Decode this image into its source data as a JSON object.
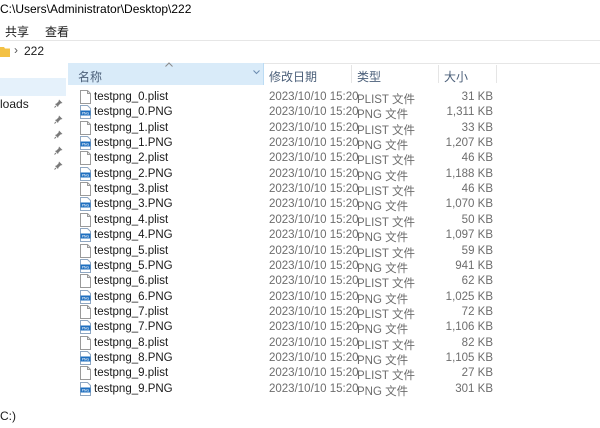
{
  "window": {
    "path": "C:\\Users\\Administrator\\Desktop\\222"
  },
  "ribbon": {
    "tabs": [
      "共享",
      "查看"
    ]
  },
  "address": {
    "crumb": "222"
  },
  "nav": {
    "items": [
      "loads",
      "C:)"
    ]
  },
  "columns": {
    "name": "名称",
    "date": "修改日期",
    "type": "类型",
    "size": "大小"
  },
  "files": [
    {
      "name": "testpng_0.plist",
      "date": "2023/10/10 15:20",
      "type": "PLIST 文件",
      "size": "31 KB",
      "icon": "document-icon"
    },
    {
      "name": "testpng_0.PNG",
      "date": "2023/10/10 15:20",
      "type": "PNG 文件",
      "size": "1,311 KB",
      "icon": "png-image-icon"
    },
    {
      "name": "testpng_1.plist",
      "date": "2023/10/10 15:20",
      "type": "PLIST 文件",
      "size": "33 KB",
      "icon": "document-icon"
    },
    {
      "name": "testpng_1.PNG",
      "date": "2023/10/10 15:20",
      "type": "PNG 文件",
      "size": "1,207 KB",
      "icon": "png-image-icon"
    },
    {
      "name": "testpng_2.plist",
      "date": "2023/10/10 15:20",
      "type": "PLIST 文件",
      "size": "46 KB",
      "icon": "document-icon"
    },
    {
      "name": "testpng_2.PNG",
      "date": "2023/10/10 15:20",
      "type": "PNG 文件",
      "size": "1,188 KB",
      "icon": "png-image-icon"
    },
    {
      "name": "testpng_3.plist",
      "date": "2023/10/10 15:20",
      "type": "PLIST 文件",
      "size": "46 KB",
      "icon": "document-icon"
    },
    {
      "name": "testpng_3.PNG",
      "date": "2023/10/10 15:20",
      "type": "PNG 文件",
      "size": "1,070 KB",
      "icon": "png-image-icon"
    },
    {
      "name": "testpng_4.plist",
      "date": "2023/10/10 15:20",
      "type": "PLIST 文件",
      "size": "50 KB",
      "icon": "document-icon"
    },
    {
      "name": "testpng_4.PNG",
      "date": "2023/10/10 15:20",
      "type": "PNG 文件",
      "size": "1,097 KB",
      "icon": "png-image-icon"
    },
    {
      "name": "testpng_5.plist",
      "date": "2023/10/10 15:20",
      "type": "PLIST 文件",
      "size": "59 KB",
      "icon": "document-icon"
    },
    {
      "name": "testpng_5.PNG",
      "date": "2023/10/10 15:20",
      "type": "PNG 文件",
      "size": "941 KB",
      "icon": "png-image-icon"
    },
    {
      "name": "testpng_6.plist",
      "date": "2023/10/10 15:20",
      "type": "PLIST 文件",
      "size": "62 KB",
      "icon": "document-icon"
    },
    {
      "name": "testpng_6.PNG",
      "date": "2023/10/10 15:20",
      "type": "PNG 文件",
      "size": "1,025 KB",
      "icon": "png-image-icon"
    },
    {
      "name": "testpng_7.plist",
      "date": "2023/10/10 15:20",
      "type": "PLIST 文件",
      "size": "72 KB",
      "icon": "document-icon"
    },
    {
      "name": "testpng_7.PNG",
      "date": "2023/10/10 15:20",
      "type": "PNG 文件",
      "size": "1,106 KB",
      "icon": "png-image-icon"
    },
    {
      "name": "testpng_8.plist",
      "date": "2023/10/10 15:20",
      "type": "PLIST 文件",
      "size": "82 KB",
      "icon": "document-icon"
    },
    {
      "name": "testpng_8.PNG",
      "date": "2023/10/10 15:20",
      "type": "PNG 文件",
      "size": "1,105 KB",
      "icon": "png-image-icon"
    },
    {
      "name": "testpng_9.plist",
      "date": "2023/10/10 15:20",
      "type": "PLIST 文件",
      "size": "27 KB",
      "icon": "document-icon"
    },
    {
      "name": "testpng_9.PNG",
      "date": "2023/10/10 15:20",
      "type": "PNG 文件",
      "size": "301 KB",
      "icon": "png-image-icon"
    }
  ],
  "colors": {
    "header_highlight": "#d9ebf9",
    "nav_highlight": "#e5f1fb",
    "png_icon": "#1e6fc0",
    "folder": "#f3c145"
  }
}
